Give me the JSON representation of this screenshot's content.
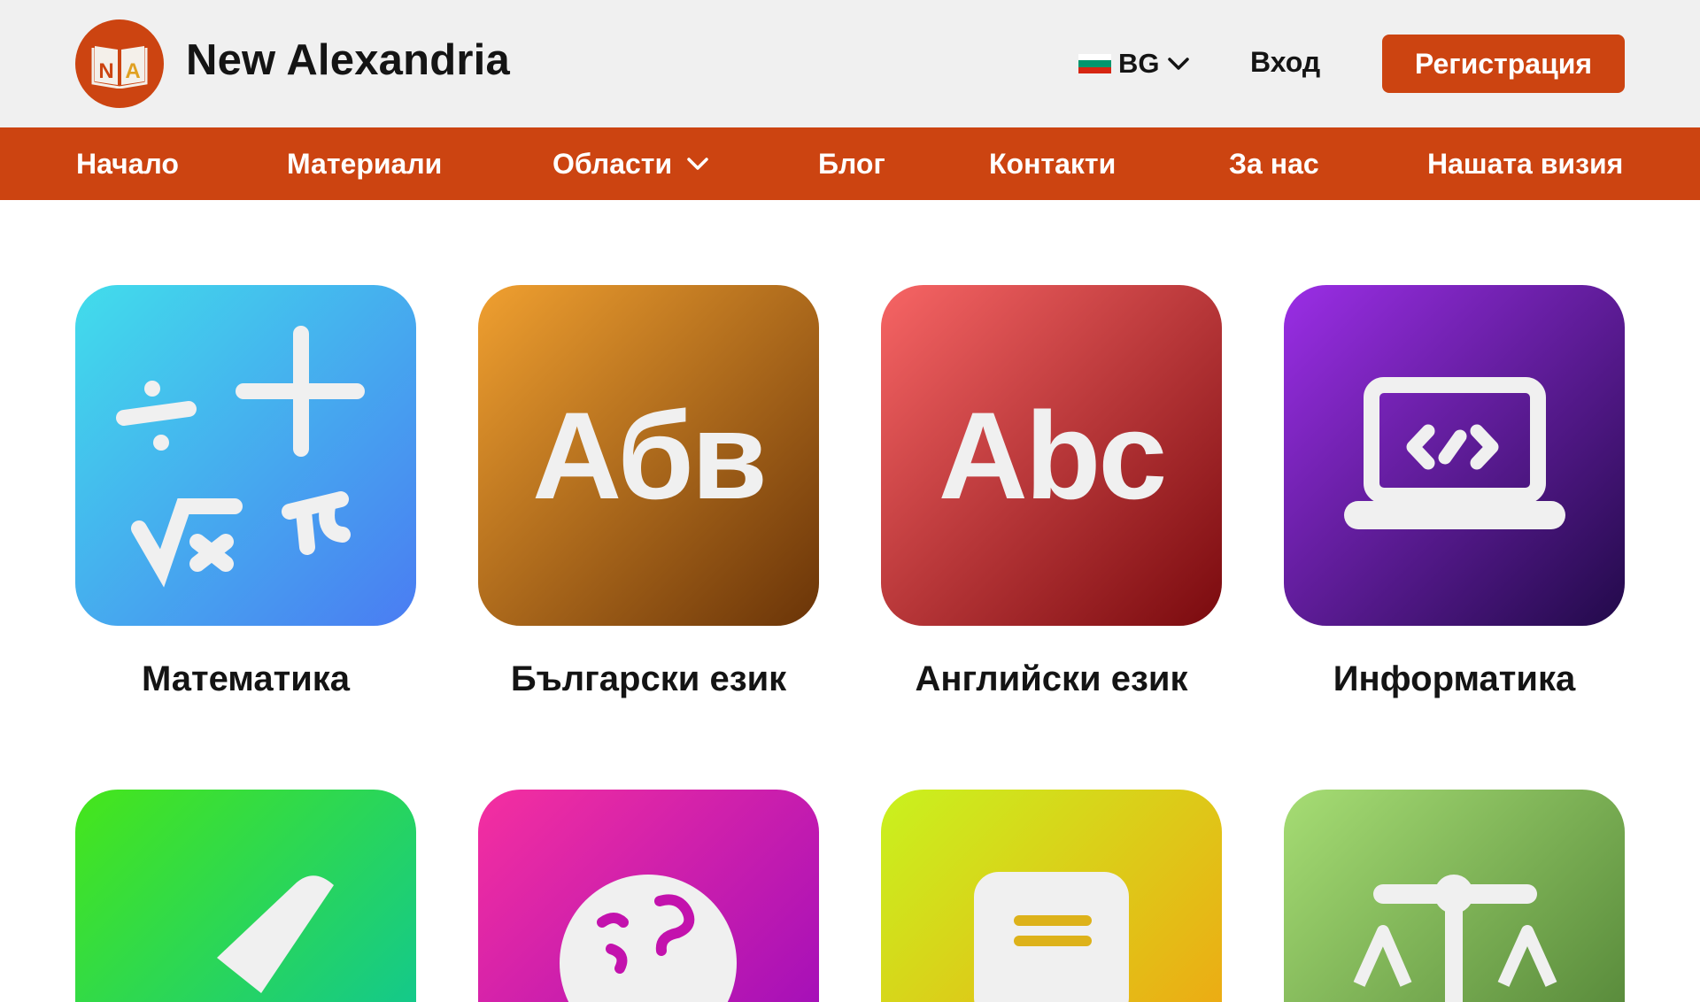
{
  "header": {
    "logo_letters": "NA",
    "brand": "New Alexandria",
    "language": {
      "code": "BG",
      "icon": "chevron-down-icon",
      "flag_colors": [
        "#ffffff",
        "#00966e",
        "#d62612"
      ]
    },
    "login_label": "Вход",
    "register_label": "Регистрация"
  },
  "colors": {
    "accent": "#cc4411",
    "header_bg": "#f0f0f0",
    "text": "#141414"
  },
  "nav": {
    "items": [
      {
        "label": "Начало"
      },
      {
        "label": "Материали"
      },
      {
        "label": "Области",
        "icon": "chevron-down-icon"
      },
      {
        "label": "Блог"
      },
      {
        "label": "Контакти"
      },
      {
        "label": "За нас"
      },
      {
        "label": "Нашата визия"
      }
    ]
  },
  "subjects": [
    {
      "label": "Математика",
      "icon": "math-symbols-icon",
      "gradient": [
        "#41ddeb",
        "#4a7cf2"
      ]
    },
    {
      "label": "Български език",
      "tile_text": "Абв",
      "icon": "cyrillic-letters-icon",
      "gradient": [
        "#f0a030",
        "#6a3408"
      ]
    },
    {
      "label": "Английски език",
      "tile_text": "Abc",
      "icon": "latin-letters-icon",
      "gradient": [
        "#f76565",
        "#7a0a0e"
      ]
    },
    {
      "label": "Информатика",
      "icon": "laptop-code-icon",
      "gradient": [
        "#9b2ee6",
        "#220a4a"
      ]
    },
    {
      "icon": "compass-icon",
      "gradient": [
        "#46e61a",
        "#14c98a"
      ]
    },
    {
      "icon": "globe-icon",
      "gradient": [
        "#f52fa0",
        "#a610b8"
      ]
    },
    {
      "icon": "document-icon",
      "gradient": [
        "#c9f21e",
        "#ecac14"
      ]
    },
    {
      "icon": "scales-icon",
      "gradient": [
        "#a6dd74",
        "#5a8c3c"
      ]
    }
  ]
}
